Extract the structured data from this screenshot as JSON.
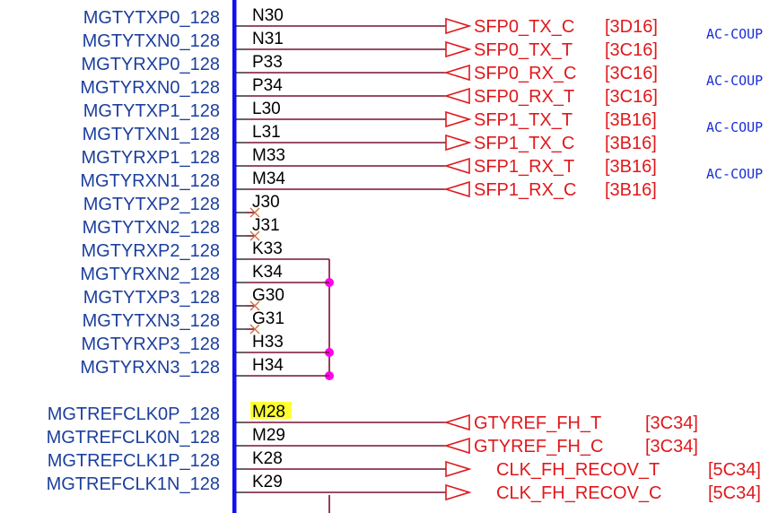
{
  "schematic": {
    "colors": {
      "pin_text": "#1c3f9e",
      "ball_text": "#000000",
      "net_text": "#e0181c",
      "wire": "#7a1030",
      "body_bar": "#1010f0",
      "junction": "#ff00ee",
      "highlight": "#ffff33",
      "note_text": "#1a2fd6"
    },
    "pins": [
      {
        "name": "MGTYTXP0_128",
        "ball": "N30",
        "net": "SFP0_TX_C",
        "ref": "[3D16]",
        "dir": "out",
        "note": "AC-COUP"
      },
      {
        "name": "MGTYTXN0_128",
        "ball": "N31",
        "net": "SFP0_TX_T",
        "ref": "[3C16]",
        "dir": "out",
        "note": ""
      },
      {
        "name": "MGTYRXP0_128",
        "ball": "P33",
        "net": "SFP0_RX_C",
        "ref": "[3C16]",
        "dir": "in",
        "note": "AC-COUP"
      },
      {
        "name": "MGTYRXN0_128",
        "ball": "P34",
        "net": "SFP0_RX_T",
        "ref": "[3C16]",
        "dir": "in",
        "note": ""
      },
      {
        "name": "MGTYTXP1_128",
        "ball": "L30",
        "net": "SFP1_TX_T",
        "ref": "[3B16]",
        "dir": "out",
        "note": "AC-COUP"
      },
      {
        "name": "MGTYTXN1_128",
        "ball": "L31",
        "net": "SFP1_TX_C",
        "ref": "[3B16]",
        "dir": "out",
        "note": ""
      },
      {
        "name": "MGTYRXP1_128",
        "ball": "M33",
        "net": "SFP1_RX_T",
        "ref": "[3B16]",
        "dir": "in",
        "note": "AC-COUP"
      },
      {
        "name": "MGTYRXN1_128",
        "ball": "M34",
        "net": "SFP1_RX_C",
        "ref": "[3B16]",
        "dir": "in",
        "note": ""
      },
      {
        "name": "MGTYTXP2_128",
        "ball": "J30",
        "net": "",
        "ref": "",
        "dir": "nc",
        "note": ""
      },
      {
        "name": "MGTYTXN2_128",
        "ball": "J31",
        "net": "",
        "ref": "",
        "dir": "nc",
        "note": ""
      },
      {
        "name": "MGTYRXP2_128",
        "ball": "K33",
        "net": "",
        "ref": "",
        "dir": "bus",
        "note": ""
      },
      {
        "name": "MGTYRXN2_128",
        "ball": "K34",
        "net": "",
        "ref": "",
        "dir": "bus",
        "note": ""
      },
      {
        "name": "MGTYTXP3_128",
        "ball": "G30",
        "net": "",
        "ref": "",
        "dir": "nc",
        "note": ""
      },
      {
        "name": "MGTYTXN3_128",
        "ball": "G31",
        "net": "",
        "ref": "",
        "dir": "nc",
        "note": ""
      },
      {
        "name": "MGTYRXP3_128",
        "ball": "H33",
        "net": "",
        "ref": "",
        "dir": "bus",
        "note": ""
      },
      {
        "name": "MGTYRXN3_128",
        "ball": "H34",
        "net": "",
        "ref": "",
        "dir": "bus",
        "note": ""
      },
      {
        "name": "MGTREFCLK0P_128",
        "ball": "M28",
        "net": "GTYREF_FH_T",
        "ref": "[3C34]",
        "dir": "in",
        "note": ""
      },
      {
        "name": "MGTREFCLK0N_128",
        "ball": "M29",
        "net": "GTYREF_FH_C",
        "ref": "[3C34]",
        "dir": "in",
        "note": ""
      },
      {
        "name": "MGTREFCLK1P_128",
        "ball": "K28",
        "net": "CLK_FH_RECOV_T",
        "ref": "[5C34]",
        "dir": "out",
        "note": ""
      },
      {
        "name": "MGTREFCLK1N_128",
        "ball": "K29",
        "net": "CLK_FH_RECOV_C",
        "ref": "[5C34]",
        "dir": "out",
        "note": ""
      }
    ]
  }
}
